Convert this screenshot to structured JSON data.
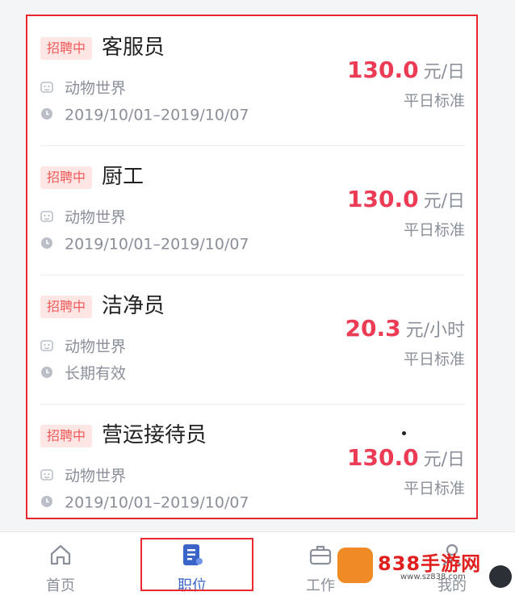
{
  "jobs": [
    {
      "badge": "招聘中",
      "title": "客服员",
      "company": "动物世界",
      "date": "2019/10/01–2019/10/07",
      "price": "130.0",
      "unit": "元/日",
      "standard": "平日标准"
    },
    {
      "badge": "招聘中",
      "title": "厨工",
      "company": "动物世界",
      "date": "2019/10/01–2019/10/07",
      "price": "130.0",
      "unit": "元/日",
      "standard": "平日标准"
    },
    {
      "badge": "招聘中",
      "title": "洁净员",
      "company": "动物世界",
      "date": "长期有效",
      "price": "20.3",
      "unit": "元/小时",
      "standard": "平日标准"
    },
    {
      "badge": "招聘中",
      "title": "营运接待员",
      "company": "动物世界",
      "date": "2019/10/01–2019/10/07",
      "price": "130.0",
      "unit": "元/日",
      "standard": "平日标准"
    }
  ],
  "tabbar": {
    "home": "首页",
    "jobs": "职位",
    "work": "工作",
    "mine": "我的"
  },
  "watermark": {
    "text": "838手游网",
    "url": "www.sz838.com"
  },
  "colors": {
    "price": "#ec3b55",
    "badge_text": "#f25a5a",
    "badge_bg": "#fde6e3",
    "active_tab": "#3a64c8",
    "highlight": "#e8282e"
  },
  "icons": {
    "company": "building-icon",
    "date": "clock-icon",
    "home": "home-icon",
    "jobs": "job-list-icon",
    "work": "briefcase-icon",
    "mine": "person-icon"
  }
}
